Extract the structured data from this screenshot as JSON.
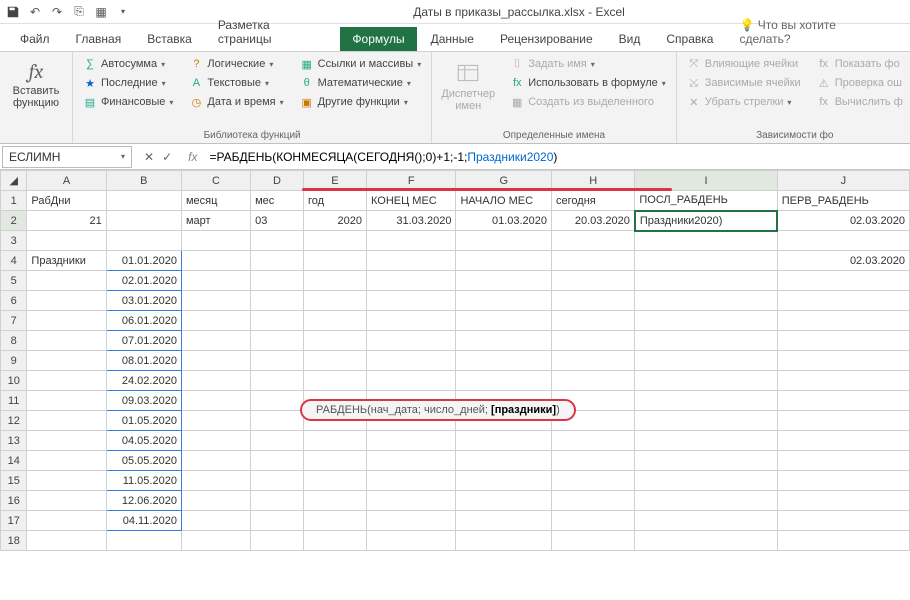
{
  "title": "Даты в приказы_рассылка.xlsx  -  Excel",
  "tabs": {
    "file": "Файл",
    "home": "Главная",
    "insert": "Вставка",
    "layout": "Разметка страницы",
    "formulas": "Формулы",
    "data": "Данные",
    "review": "Рецензирование",
    "view": "Вид",
    "help": "Справка",
    "tell": "Что вы хотите сделать?"
  },
  "ribbon": {
    "insert_fn": "Вставить функцию",
    "lib": {
      "auto": "Автосумма",
      "recent": "Последние",
      "fin": "Финансовые",
      "logic": "Логические",
      "text": "Текстовые",
      "date": "Дата и время",
      "lookup": "Ссылки и массивы",
      "math": "Математические",
      "more": "Другие функции"
    },
    "lib_label": "Библиотека функций",
    "names": {
      "mgr": "Диспетчер имен",
      "define": "Задать имя",
      "use": "Использовать в формуле",
      "create": "Создать из выделенного"
    },
    "names_label": "Определенные имена",
    "deps": {
      "prec": "Влияющие ячейки",
      "dep": "Зависимые ячейки",
      "rem": "Убрать стрелки",
      "show": "Показать фо",
      "err": "Проверка ош",
      "eval": "Вычислить ф"
    },
    "deps_label": "Зависимости фо"
  },
  "namebox": "ЕСЛИМН",
  "formula": {
    "pre": "=РАБДЕНЬ(КОНМЕСЯЦА(СЕГОДНЯ();0)+1;-1;",
    "nm": "Праздники2020",
    "post": ")"
  },
  "tooltip": {
    "fn": "РАБДЕНЬ",
    "args": "(нач_дата; число_дней; ",
    "bold": "[праздники]",
    "end": ")"
  },
  "cols": [
    "A",
    "B",
    "C",
    "D",
    "E",
    "F",
    "G",
    "H",
    "I",
    "J"
  ],
  "headers": {
    "A": "РабДни",
    "C": "месяц",
    "D": "мес",
    "E": "год",
    "F": "КОНЕЦ МЕС",
    "G": "НАЧАЛО МЕС",
    "H": "сегодня",
    "I": "ПОСЛ_РАБДЕНЬ",
    "J": "ПЕРВ_РАБДЕНЬ"
  },
  "row2": {
    "A": "21",
    "C": "март",
    "D": "03",
    "E": "2020",
    "F": "31.03.2020",
    "G": "01.03.2020",
    "H": "20.03.2020",
    "I": "Праздники2020)",
    "J": "02.03.2020"
  },
  "row4": {
    "A": "Праздники",
    "J": "02.03.2020"
  },
  "holidays": [
    "01.01.2020",
    "02.01.2020",
    "03.01.2020",
    "06.01.2020",
    "07.01.2020",
    "08.01.2020",
    "24.02.2020",
    "09.03.2020",
    "01.05.2020",
    "04.05.2020",
    "05.05.2020",
    "11.05.2020",
    "12.06.2020",
    "04.11.2020"
  ]
}
